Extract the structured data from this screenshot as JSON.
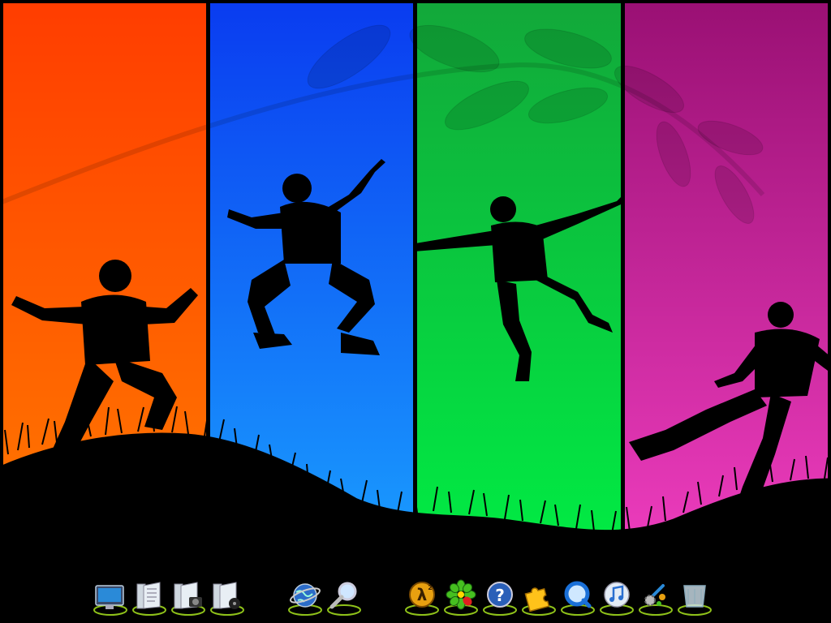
{
  "wallpaper": {
    "panels": [
      {
        "name": "orange",
        "top": "#ff3d00",
        "bottom": "#ff7a00"
      },
      {
        "name": "blue",
        "top": "#0a3cf0",
        "bottom": "#1aa0ff"
      },
      {
        "name": "green",
        "top": "#12a83a",
        "bottom": "#00ee44"
      },
      {
        "name": "magenta",
        "top": "#9a1074",
        "bottom": "#f03ec0"
      }
    ],
    "silhouette": "#000000"
  },
  "dock": {
    "groups": [
      {
        "name": "system",
        "items": [
          "computer-icon",
          "documents-icon",
          "pictures-icon",
          "music-icon"
        ]
      },
      {
        "name": "web",
        "items": [
          "internet-globe-icon",
          "search-icon"
        ]
      },
      {
        "name": "apps",
        "items": [
          "half-life-2-icon",
          "icq-flower-icon",
          "help-icon",
          "puzzle-icon",
          "quicktime-icon",
          "itunes-icon",
          "settings-icon",
          "recycle-bin-icon"
        ]
      }
    ],
    "accent": "#8fc21a"
  }
}
